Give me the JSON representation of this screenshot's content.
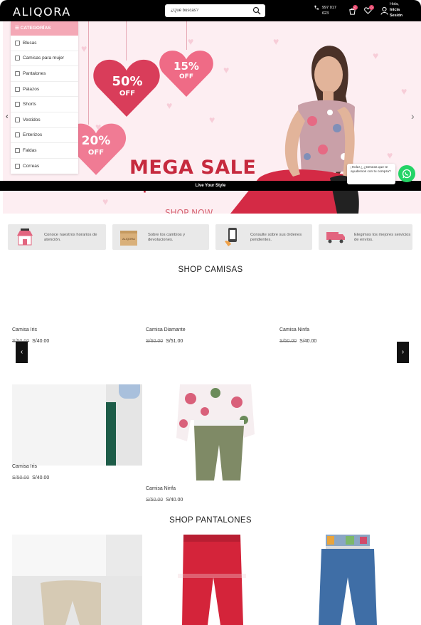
{
  "header": {
    "logo": "ALIQORA",
    "search_placeholder": "¿Qué buscas?",
    "phone": "997 017 623",
    "cart_count": "0",
    "wishlist_count": "0",
    "greeting": "Hola,",
    "login_line1": "Inicia",
    "login_line2": "Sesión"
  },
  "categories": {
    "title": "CATEGORÍAS",
    "items": [
      {
        "label": "Blusas",
        "icon": "blouse-icon"
      },
      {
        "label": "Camisas para mujer",
        "icon": "shirt-icon"
      },
      {
        "label": "Pantalones",
        "icon": "pants-icon"
      },
      {
        "label": "Palazos",
        "icon": "palazzo-icon"
      },
      {
        "label": "Shorts",
        "icon": "shorts-icon"
      },
      {
        "label": "Vestidos",
        "icon": "dress-icon"
      },
      {
        "label": "Enterizos",
        "icon": "jumpsuit-icon"
      },
      {
        "label": "Faldas",
        "icon": "skirt-icon"
      },
      {
        "label": "Correas",
        "icon": "belt-icon"
      }
    ]
  },
  "banner": {
    "discount1": "50%",
    "discount2": "15%",
    "discount3": "20%",
    "off": "OFF",
    "headline": "MEGA SALE",
    "subline": "¡En toda la tienda!",
    "cta": "SHOP NOW",
    "strip": "Live Your Style",
    "accent": "#c62a3e"
  },
  "whatsapp": {
    "message": "¡Hola! ¿ ¿Deseas que te ayudemos con tu compra?",
    "color": "#25d366"
  },
  "info_cards": [
    {
      "text": "Conoce nuestros horarios de atención.",
      "icon": "store-icon"
    },
    {
      "text": "Sobre los cambios y devoluciones.",
      "icon": "box-icon"
    },
    {
      "text": "Consulte sobre sus órdenes pendientes.",
      "icon": "phone-order-icon"
    },
    {
      "text": "Elegimos los mejores servicios de envíos.",
      "icon": "truck-icon"
    }
  ],
  "shop_camisas": {
    "title": "SHOP CAMISAS",
    "row1": [
      {
        "name": "Camisa Iris",
        "old": "S/50.00",
        "price": "S/40.00"
      },
      {
        "name": "Camisa Diamante",
        "old": "S/60.00",
        "price": "S/51.00"
      },
      {
        "name": "Camisa Ninfa",
        "old": "S/50.00",
        "price": "S/40.00"
      }
    ],
    "row2": [
      {
        "name": "Camisa Iris",
        "old": "S/50.00",
        "price": "S/40.00"
      },
      {
        "name": "Camisa Ninfa",
        "old": "S/50.00",
        "price": "S/40.00"
      }
    ]
  },
  "shop_pantalones": {
    "title": "SHOP PANTALONES"
  }
}
